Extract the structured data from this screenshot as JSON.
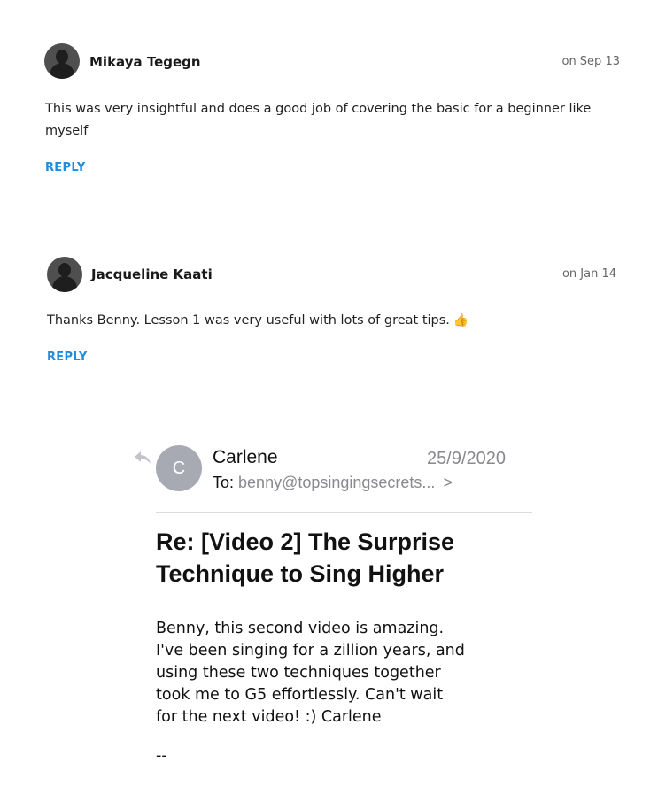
{
  "comments": [
    {
      "author": "Mikaya Tegegn",
      "date": "on Sep 13",
      "text_line1": "This was very insightful and does a good job of covering the basic for a beginner like",
      "text_line2": "myself",
      "reply_label": "REPLY"
    },
    {
      "author": "Jacqueline Kaati",
      "date": "on Jan 14",
      "text": "Thanks Benny. Lesson 1 was very useful with lots of great tips.",
      "emoji": "👍",
      "reply_label": "REPLY"
    }
  ],
  "email": {
    "avatar_initial": "C",
    "sender": "Carlene",
    "date": "25/9/2020",
    "to_label": "To:",
    "to_address": "benny@topsingingsecrets...",
    "chevron": ">",
    "subject": "Re: [Video 2] The Surprise Technique to Sing Higher",
    "body": "Benny, this second video is amazing.\nI've been singing for a zillion years, and\nusing these two techniques together\ntook me to G5 effortlessly.  Can't wait\nfor the next video!  :) Carlene",
    "signature": "--"
  },
  "colors": {
    "reply_link": "#1e8ddf",
    "avatar_bg": "#4f4f4f",
    "email_avatar_bg": "#a8aab3",
    "muted_text": "#8a8a8e"
  },
  "icons": {
    "reply_arrow": "reply-arrow-icon",
    "user_avatar": "user-silhouette-icon",
    "chevron": "chevron-right-icon"
  }
}
